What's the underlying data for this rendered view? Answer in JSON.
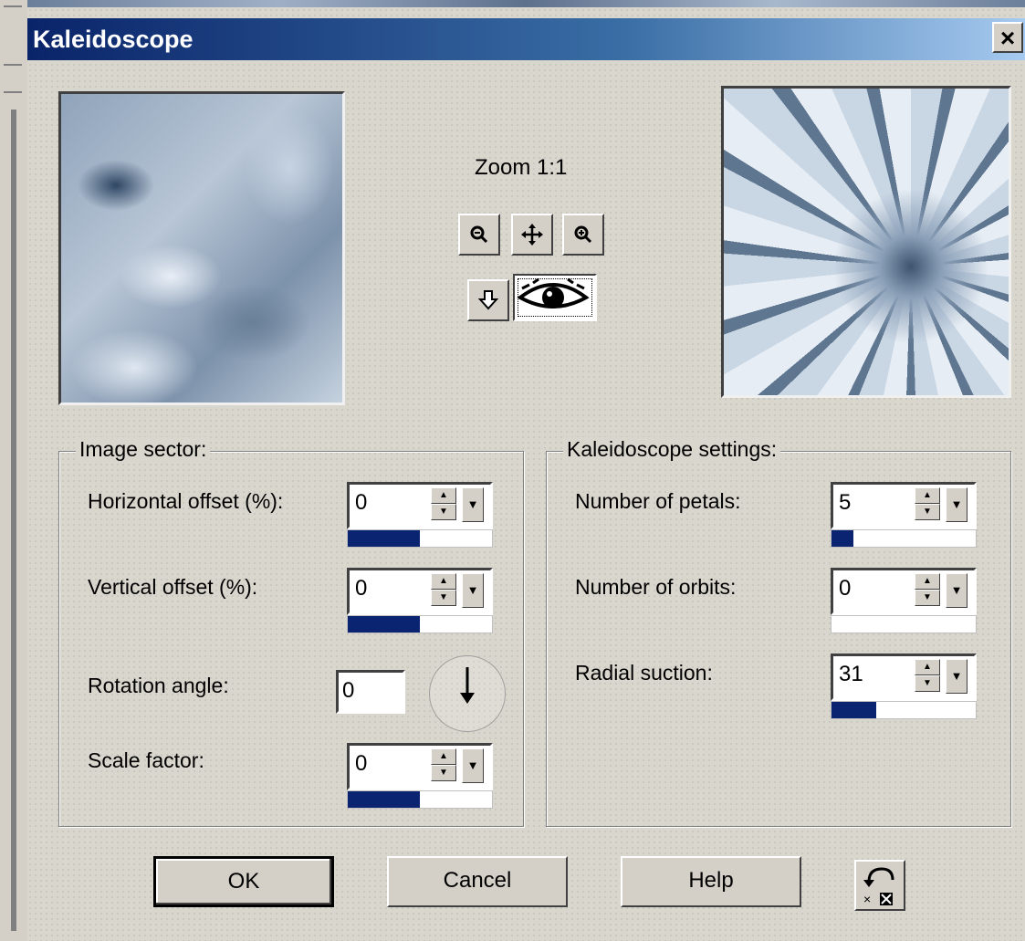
{
  "window": {
    "title": "Kaleidoscope",
    "close_label": "×"
  },
  "zoom": {
    "label": "Zoom 1:1"
  },
  "image_sector": {
    "title": "Image sector:",
    "horizontal_offset": {
      "label": "Horizontal offset (%):",
      "value": "0",
      "level": 0.5
    },
    "vertical_offset": {
      "label": "Vertical offset (%):",
      "value": "0",
      "level": 0.5
    },
    "rotation_angle": {
      "label": "Rotation angle:",
      "value": "0"
    },
    "scale_factor": {
      "label": "Scale factor:",
      "value": "0",
      "level": 0.5
    }
  },
  "kaleidoscope_settings": {
    "title": "Kaleidoscope settings:",
    "petals": {
      "label": "Number of petals:",
      "value": "5",
      "level": 0.15
    },
    "orbits": {
      "label": "Number of orbits:",
      "value": "0",
      "level": 0
    },
    "radial_suction": {
      "label": "Radial suction:",
      "value": "31",
      "level": 0.31
    }
  },
  "buttons": {
    "ok": "OK",
    "cancel": "Cancel",
    "help": "Help"
  },
  "colors": {
    "titlebar_start": "#0a246a",
    "titlebar_end": "#a6caf0",
    "progress": "#0a2472"
  },
  "icons": [
    "zoom-out-icon",
    "pan-icon",
    "zoom-in-icon",
    "proof-icon",
    "eye-icon",
    "reset-icon"
  ]
}
